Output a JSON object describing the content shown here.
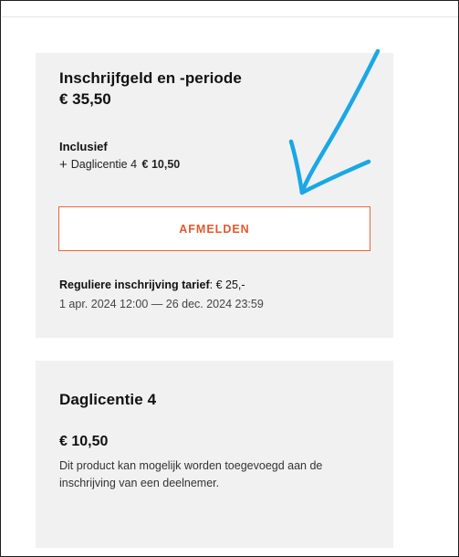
{
  "registration_card": {
    "title": "Inschrijfgeld en -periode",
    "price": "€ 35,50",
    "inclusief_label": "Inclusief",
    "addon_icon": "plus-icon",
    "addon_name": "Daglicentie 4",
    "addon_price": "€ 10,50",
    "button_label": "AFMELDEN",
    "tarief_label": "Reguliere inschrijving tarief",
    "tarief_value": ": € 25,-",
    "period": "1 apr. 2024 12:00 — 26 dec. 2024 23:59"
  },
  "product_card": {
    "title": "Daglicentie 4",
    "price": "€ 10,50",
    "description": "Dit product kan mogelijk worden toegevoegd aan de inschrijving van een deelnemer."
  },
  "annotation": {
    "arrow_color": "#1aa7e6",
    "arrow_icon": "pointing-arrow"
  },
  "colors": {
    "accent": "#e05a2c",
    "card_background": "#f1f1f1"
  }
}
